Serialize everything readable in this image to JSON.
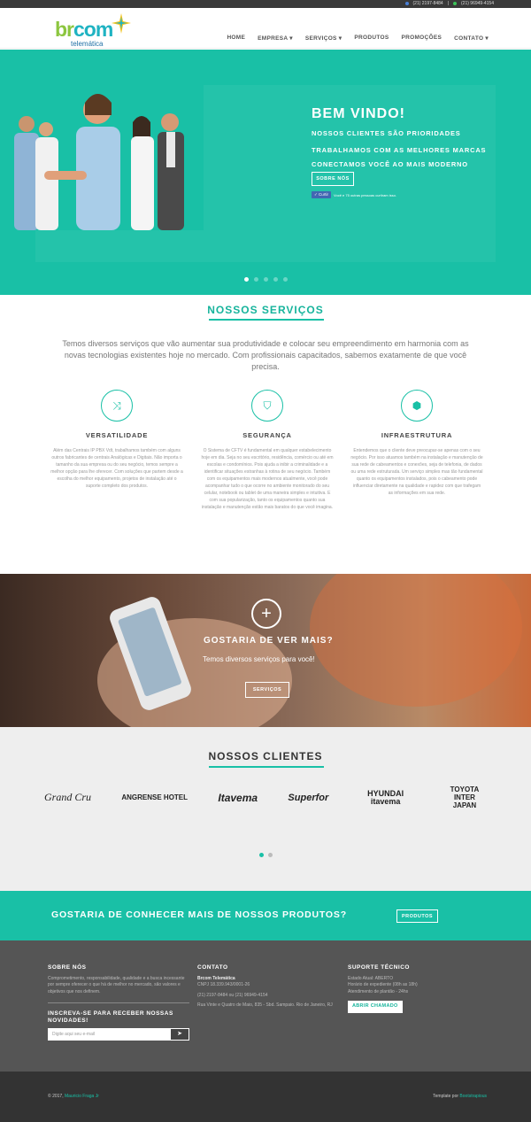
{
  "topbar": {
    "phone1": "(21) 2197-8484",
    "phone2": "(21) 96949-4154"
  },
  "logo": {
    "brand_b": "br",
    "brand_c": "com",
    "sub": "telemática"
  },
  "nav": [
    "HOME",
    "EMPRESA ▾",
    "SERVIÇOS ▾",
    "PRODUTOS",
    "PROMOÇÕES",
    "CONTATO ▾"
  ],
  "hero": {
    "title": "BEM VINDO!",
    "lines": [
      "NOSSOS CLIENTES SÃO PRIORIDADES",
      "TRABALHAMOS COM AS MELHORES MARCAS",
      "CONECTAMOS VOCÊ AO MAIS MODERNO"
    ],
    "button": "SOBRE NÓS",
    "like": "Curtir",
    "like_text": "Você e 75 outras pessoas curtiram isso."
  },
  "servicos": {
    "title": "NOSSOS SERVIÇOS",
    "intro": "Temos diversos serviços que vão aumentar sua produtividade e colocar seu empreendimento em harmonia com as novas tecnologias existentes hoje no mercado. Com profissionais capacitados, sabemos exatamente de que você precisa.",
    "items": [
      {
        "icon": "shuffle-icon",
        "title": "VERSATILIDADE",
        "text": "Além das Centrais IP PBX Vdt, trabalhamos também com alguns outros fabricantes de centrais Analógicas e Digitais. Não importa o tamanho da sua empresa ou do seu negócio, temos sempre a melhor opção para lhe oferecer. Com soluções que partem desde a escolha do melhor equipamento, projetos de instalação até o suporte completo dos produtos."
      },
      {
        "icon": "shield-icon",
        "title": "SEGURANÇA",
        "text": "O Sistema de CFTV é fundamental em qualquer estabelecimento hoje em dia. Seja no seu escritório, residência, comércio ou até em escolas e condomínios. Pois ajuda a inibir a criminalidade e a identificar situações estranhas à rotina de seu negócio. Também com os equipamentos mais modernos atualmente, você pode acompanhar tudo o que ocorre no ambiente monitorado do seu celular, notebook ou tablet de uma maneira simples e intuitiva. E com sua popularização, tanto os equipamentos quanto sua instalação e manutenção estão mais baratos do que você imagina."
      },
      {
        "icon": "cube-icon",
        "title": "INFRAESTRUTURA",
        "text": "Entendemos que o cliente deve preocupar-se apenas com o seu negócio. Por isso atuamos também na instalação e manutenção de sua rede de cabeamentos e conexões, seja de telefonia, de dados ou uma rede estruturada. Um serviço simples mas tão fundamental quanto os equipamentos instalados, pois o cabeamento pode influenciar diretamente na qualidade e rapidez com que trafegam as informações em sua rede."
      }
    ]
  },
  "mais": {
    "title": "GOSTARIA DE VER MAIS?",
    "subtitle": "Temos diversos serviços para você!",
    "button": "SERVIÇOS"
  },
  "clientes": {
    "title": "NOSSOS CLIENTES",
    "logos": [
      "Grand Cru",
      "ANGRENSE HOTEL",
      "Itavema",
      "Superfor",
      "HYUNDAI itavema",
      "TOYOTA INTER JAPAN"
    ]
  },
  "cta": {
    "text": "GOSTARIA DE CONHECER MAIS DE NOSSOS PRODUTOS?",
    "button": "PRODUTOS"
  },
  "footer": {
    "sobre": {
      "title": "SOBRE NÓS",
      "text": "Comprometimento, responsabilidade, qualidade e a busca incessante por sempre oferecer o que há de melhor no mercado, são valores e objetivos que nos definem."
    },
    "news": {
      "title": "INSCREVA-SE PARA RECEBER NOSSAS NOVIDADES!",
      "placeholder": "Digite aqui seu e-mail"
    },
    "contato": {
      "title": "CONTATO",
      "company": "Brcom Telemática",
      "cnpj": "CNPJ 18.339.943/0001-26",
      "phones": "(21) 2197-8484 ou (21) 96949-4154",
      "address": "Rua Vinte e Quatro de Maio, 835 - Sbd. Sampaio. Rio de Janeiro, RJ"
    },
    "suporte": {
      "title": "SUPORTE TÉCNICO",
      "estado": "Estado Atual: ABERTO",
      "horario": "Horário de expediente (08h as 18h)",
      "plantao": "Atendimento de plantão - 24hs",
      "button": "ABRIR CHAMADO"
    }
  },
  "bottom": {
    "left": "© 2017,",
    "left_link": "Mauricio Fraga Jr",
    "right": "Template por",
    "right_link": "Bootstrapious"
  }
}
